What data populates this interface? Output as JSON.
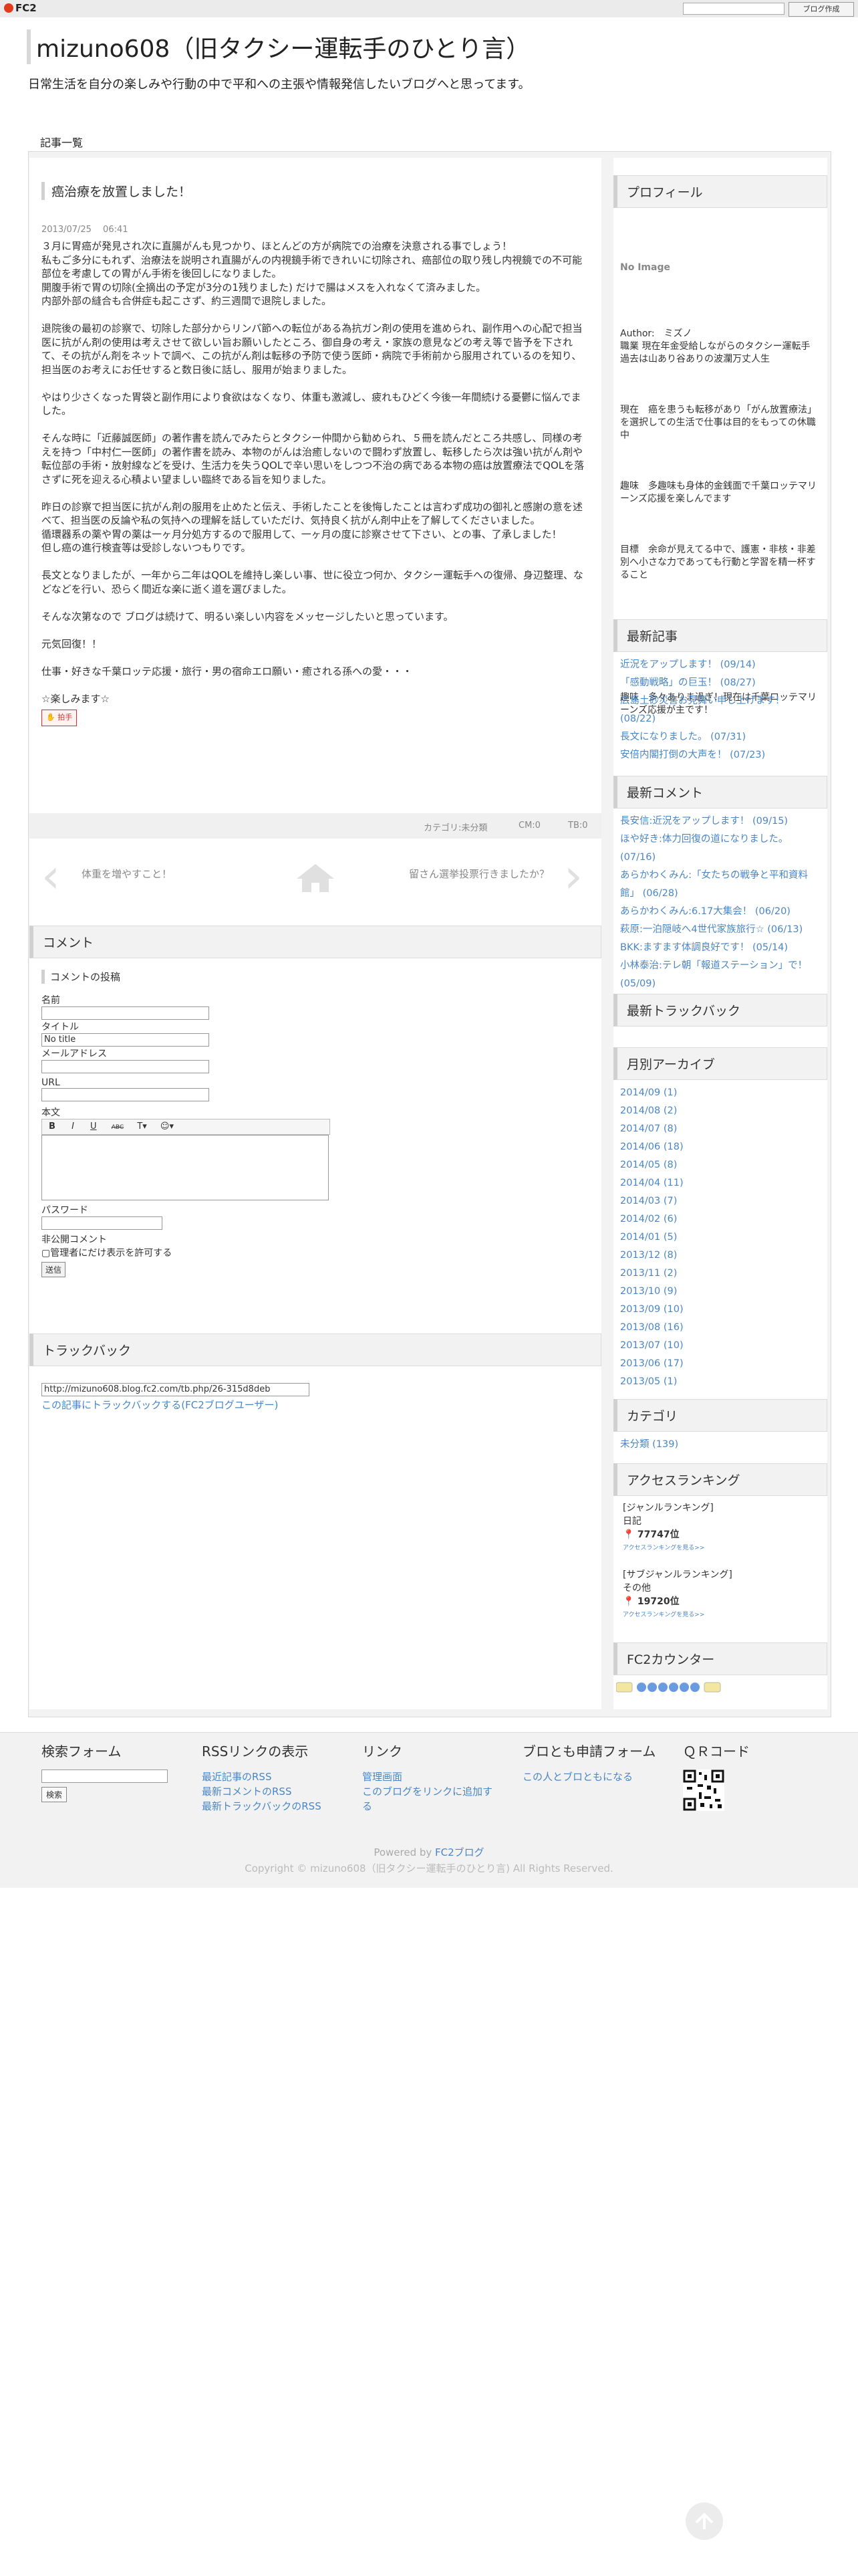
{
  "topbar": {
    "logo": "FC2",
    "create_blog": "ブログ作成"
  },
  "header": {
    "title": "mizuno608（旧タクシー運転手のひとり言）",
    "description": "日常生活を自分の楽しみや行動の中で平和への主張や情報発信したいブログへと思ってます。",
    "nav": "記事一覧"
  },
  "article": {
    "title": "癌治療を放置しました！",
    "date": "2013/07/25　 06:41",
    "paragraphs": [
      "３月に胃癌が発見され次に直腸がんも見つかり、ほとんどの方が病院での治療を決意される事でしょう！\n私もご多分にもれず、治療法を説明され直腸がんの内視鏡手術できれいに切除され、癌部位の取り残し内視鏡での不可能部位を考慮しての胃がん手術を後回しになりました。\n開腹手術で胃の切除(全摘出の予定が3分の1残りました) だけで腸はメスを入れなくて済みました。\n内部外部の縫合も合併症も起こさず、約三週間で退院しました。",
      "退院後の最初の診察で、切除した部分からリンパ節への転位がある為抗ガン剤の使用を進められ、副作用への心配で担当医に抗がん剤の使用は考えさせて欲しい旨お願いしたところ、御自身の考え・家族の意見などの考え等で皆予を下されて、その抗がん剤をネットで調べ、この抗がん剤は転移の予防で使う医師・病院で手術前から服用されているのを知り、担当医のお考えにお任せすると数日後に話し、服用が始まりました。",
      "やはり少さくなった胃袋と副作用により食欲はなくなり、体重も激減し、疲れもひどく今後一年間続ける憂鬱に悩んでました。",
      "そんな時に「近藤誠医師」の著作書を読んでみたらとタクシー仲間から勧められ、５冊を読んだところ共感し、同様の考えを持つ「中村仁一医師」の著作書を読み、本物のがんは治癒しないので闘わず放置し、転移したら次は強い抗がん剤や転位部の手術・放射線などを受け、生活力を失うQOLで辛い思いをしつつ不治の病である本物の癌は放置療法でQOLを落さずに死を迎える心積よい望ましい臨終である旨を知りました。",
      "昨日の診察で担当医に抗がん剤の服用を止めたと伝え、手術したことを後悔したことは言わず成功の御礼と感謝の意を述べて、担当医の反論や私の気持への理解を話していただけ、気持良く抗がん剤中止を了解してくださいました。\n循環器系の薬や胃の薬は一ヶ月分処方するので服用して、一ヶ月の度に診察させて下さい、との事、了承しました！\n但し癌の進行検査等は受診しないつもりです。",
      "長文となりましたが、一年から二年はQOLを維持し楽しい事、世に役立つ何か、タクシー運転手への復帰、身辺整理、などなどを行い、恐らく間近な楽に逝く道を選びました。",
      "そんな次第なので ブログは続けて、明るい楽しい内容をメッセージしたいと思っています。",
      "元気回復！！",
      "仕事・好きな千葉ロッテ応援・旅行・男の宿命エロ願い・癒される孫への愛・・・",
      "☆楽しみます☆"
    ],
    "clap": "拍手",
    "meta": {
      "category": "カテゴリ:未分類",
      "cm": "CM:0",
      "tb": "TB:0"
    },
    "prev": "体重を増やすこと！",
    "next": "留さん選挙投票行きましたか？"
  },
  "comments": {
    "heading": "コメント",
    "form_heading": "コメントの投稿",
    "name_label": "名前",
    "title_label": "タイトル",
    "title_value": "No title",
    "email_label": "メールアドレス",
    "url_label": "URL",
    "body_label": "本文",
    "password_label": "パスワード",
    "private_label": "非公開コメント",
    "private_check": "管理者にだけ表示を許可する",
    "submit": "送信"
  },
  "trackback": {
    "heading": "トラックバック",
    "url": "http://mizuno608.blog.fc2.com/tb.php/26-315d8deb",
    "link": "この記事にトラックバックする(FC2ブログユーザー)"
  },
  "sidebar": {
    "profile": {
      "heading": "プロフィール",
      "noimage": "No Image",
      "author": "Author:　ミズノ\n職業 現在年金受給しながらのタクシー運転手\n過去は山あり谷ありの波瀾万丈人生",
      "p2": "現在　癌を患うも転移があり「がん放置療法」を選択しての生活で仕事は目的をもっての休職中",
      "p3": "趣味　多趣味も身体的金銭面で千葉ロッテマリーンズ応援を楽しんでます",
      "p4": "目標　余命が見えてる中で、護憲・非核・非差別へ小さな力であっても行動と学習を精一杯すること",
      "p5": "趣味　多々ありま過ぎ！現在は千葉ロッテマリーンズ応援が主です！"
    },
    "recent_posts": {
      "heading": "最新記事",
      "items": [
        "近況をアップします！ (09/14)",
        "「感動戦略」の巨玉！ (08/27)",
        "広島土砂災害お見舞い申し上げます！ (08/22)",
        "長文になりました。 (07/31)",
        "安倍内閣打倒の大声を！ (07/23)"
      ]
    },
    "recent_comments": {
      "heading": "最新コメント",
      "items": [
        "長安信:近況をアップします！ (09/15)",
        "ほや好き:体力回復の道になりました。 (07/16)",
        "あらかわくみん:「女たちの戦争と平和資料館」 (06/28)",
        "あらかわくみん:6.17大集会！ (06/20)",
        "萩原:一泊隠岐へ4世代家族旅行☆ (06/13)",
        "BKK:ますます体調良好です！ (05/14)",
        "小林泰治:テレ朝「報道ステーション」で！ (05/09)"
      ]
    },
    "trackbacks": {
      "heading": "最新トラックバック"
    },
    "archive": {
      "heading": "月別アーカイブ",
      "items": [
        "2014/09 (1)",
        "2014/08 (2)",
        "2014/07 (8)",
        "2014/06 (18)",
        "2014/05 (8)",
        "2014/04 (11)",
        "2014/03 (7)",
        "2014/02 (6)",
        "2014/01 (5)",
        "2013/12 (8)",
        "2013/11 (2)",
        "2013/10 (9)",
        "2013/09 (10)",
        "2013/08 (16)",
        "2013/07 (10)",
        "2013/06 (17)",
        "2013/05 (1)"
      ]
    },
    "category": {
      "heading": "カテゴリ",
      "item": "未分類 (139)"
    },
    "ranking": {
      "heading": "アクセスランキング",
      "genre_label": "[ジャンルランキング]",
      "genre": "日記",
      "genre_rank": "77747位",
      "sub_label": "[サブジャンルランキング]",
      "sub": "その他",
      "sub_rank": "19720位",
      "more": "アクセスランキングを見る>>"
    },
    "counter": {
      "heading": "FC2カウンター"
    }
  },
  "footer": {
    "search": {
      "heading": "検索フォーム",
      "button": "検索"
    },
    "rss": {
      "heading": "RSSリンクの表示",
      "items": [
        "最近記事のRSS",
        "最新コメントのRSS",
        "最新トラックバックのRSS"
      ]
    },
    "links": {
      "heading": "リンク",
      "items": [
        "管理画面",
        "このブログをリンクに追加する"
      ]
    },
    "friend": {
      "heading": "ブロとも申請フォーム",
      "link": "この人とブロともになる"
    },
    "qr": {
      "heading": "ＱＲコード"
    },
    "powered_prefix": "Powered by ",
    "powered_link": "FC2ブログ",
    "copyright": "Copyright © mizuno608（旧タクシー運転手のひとり言) All Rights Reserved."
  }
}
